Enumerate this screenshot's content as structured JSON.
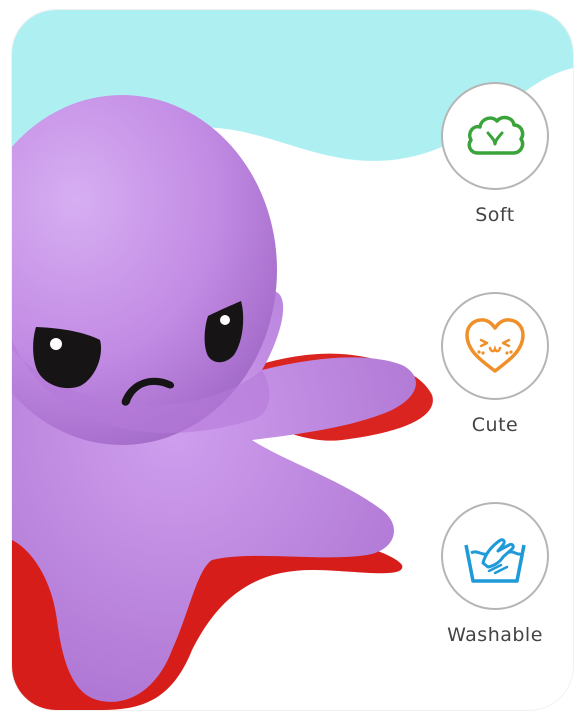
{
  "features": [
    {
      "label": "Soft",
      "icon": "cloud-icon",
      "color": "#3aa43a"
    },
    {
      "label": "Cute",
      "icon": "heart-face-icon",
      "color": "#f0902a"
    },
    {
      "label": "Washable",
      "icon": "hand-wash-icon",
      "color": "#1e9ad8"
    }
  ],
  "colors": {
    "wave": "#aef0f2",
    "plush_purple": "#c48ee6",
    "plush_red": "#e2221e",
    "ring_border": "#b5b5b5"
  }
}
